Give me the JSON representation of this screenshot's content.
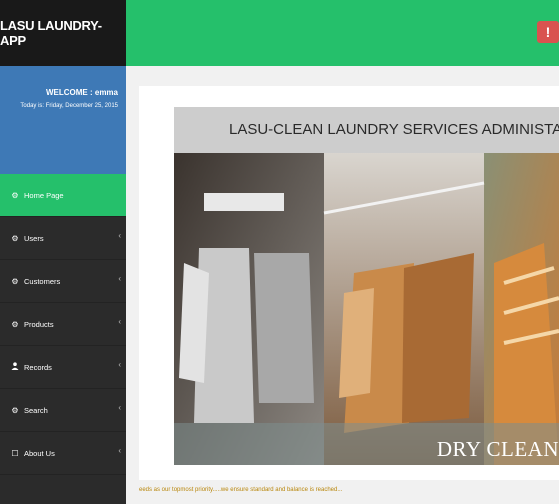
{
  "app": {
    "title": "LASU LAUNDRY-APP"
  },
  "profile": {
    "welcome": "WELCOME : emma",
    "date": "Today is: Friday, December 25, 2015"
  },
  "sidebar": {
    "items": [
      {
        "label": "Home Page",
        "icon": "dashboard-icon",
        "active": true
      },
      {
        "label": "Users",
        "icon": "dashboard-icon",
        "has_submenu": true
      },
      {
        "label": "Customers",
        "icon": "dashboard-icon",
        "has_submenu": true
      },
      {
        "label": "Products",
        "icon": "dashboard-icon",
        "has_submenu": true
      },
      {
        "label": "Records",
        "icon": "user-icon",
        "has_submenu": true
      },
      {
        "label": "Search",
        "icon": "dashboard-icon",
        "has_submenu": true
      },
      {
        "label": "About Us",
        "icon": "square-icon",
        "has_submenu": true
      }
    ]
  },
  "topbar": {
    "alert_icon": "alert-icon",
    "alert_symbol": "!",
    "alert_color": "#d9534f",
    "accent": "#25c06b"
  },
  "banner": {
    "title": "LASU-CLEAN LAUNDRY SERVICES ADMINISTATORS",
    "caption": "DRY CLEAN"
  },
  "footer": {
    "tagline": "eeds as our topmost priority.....we ensure standard and balance is reached..."
  }
}
